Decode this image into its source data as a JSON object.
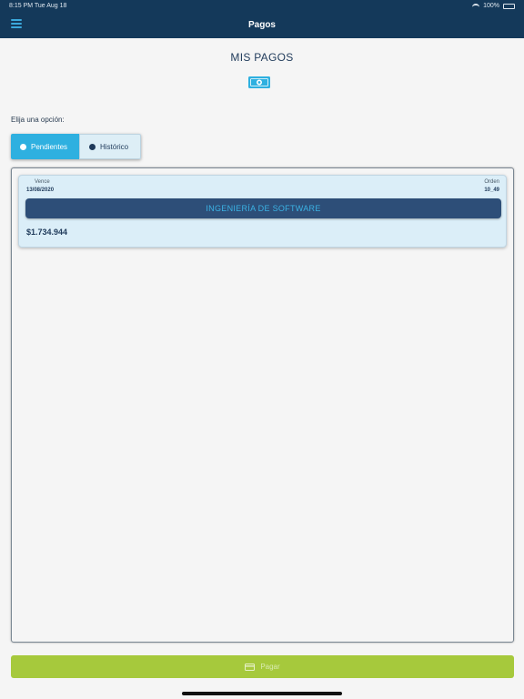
{
  "status_bar": {
    "time_date": "8:15 PM  Tue Aug 18",
    "battery": "100%"
  },
  "header": {
    "title": "Pagos"
  },
  "page": {
    "title": "MIS PAGOS",
    "icon": "money-bill-icon",
    "choose_label": "Elija una opción:"
  },
  "segment": {
    "options": [
      {
        "label": "Pendientes",
        "selected": true
      },
      {
        "label": "Histórico",
        "selected": false
      }
    ]
  },
  "payments": [
    {
      "due_label": "Vence",
      "due_date": "13/08/2020",
      "order_label": "Orden",
      "order_number": "10_49",
      "course": "INGENIERÍA DE SOFTWARE",
      "amount": "$1.734.944"
    }
  ],
  "footer": {
    "pay_label": "Pagar",
    "icon": "credit-card-icon"
  },
  "colors": {
    "header_bg": "#14395a",
    "accent_blue": "#2eb0e0",
    "course_bar": "#2d4e78",
    "pay_button": "#a6c93c"
  }
}
